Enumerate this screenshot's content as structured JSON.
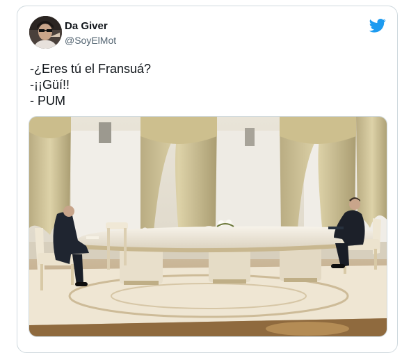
{
  "tweet": {
    "display_name": "Da Giver",
    "handle": "@SoyElMot",
    "lines": [
      "-¿Eres tú el Fransuá?",
      "-¡¡Güí!!",
      "- PUM"
    ]
  },
  "icons": {
    "brand": "twitter-bird-icon",
    "brand_color": "#1d9bf0"
  }
}
